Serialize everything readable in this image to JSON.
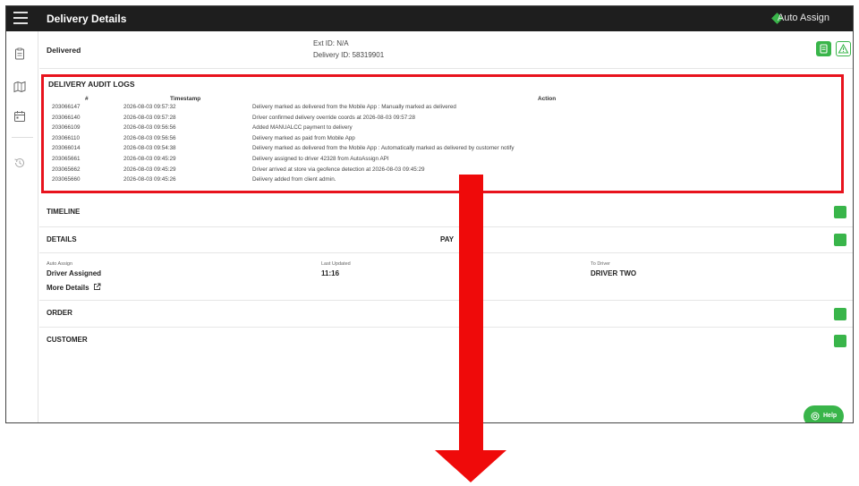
{
  "header": {
    "title": "Delivery Details",
    "auto_assign_label": "Auto Assign"
  },
  "colors": {
    "accent": "#39b54a",
    "highlight": "#e8131d",
    "topbar": "#1e1e1e"
  },
  "status": {
    "label": "Delivered",
    "ext_id": "Ext ID: N/A",
    "delivery_id": "Delivery ID: 58319901"
  },
  "audit": {
    "title": "DELIVERY AUDIT LOGS",
    "columns": [
      "#",
      "Timestamp",
      "Action"
    ],
    "rows": [
      {
        "id": "203066147",
        "timestamp": "2026-08-03 09:57:32",
        "action": "Delivery marked as delivered from the Mobile App : Manually marked as delivered"
      },
      {
        "id": "203066140",
        "timestamp": "2026-08-03 09:57:28",
        "action": "Driver confirmed delivery override coords at 2026-08-03 09:57:28"
      },
      {
        "id": "203066109",
        "timestamp": "2026-08-03 09:56:56",
        "action": "Added MANUALCC payment to delivery"
      },
      {
        "id": "203066110",
        "timestamp": "2026-08-03 09:56:56",
        "action": "Delivery marked as paid from Mobile App"
      },
      {
        "id": "203066014",
        "timestamp": "2026-08-03 09:54:38",
        "action": "Delivery marked as delivered from the Mobile App : Automatically marked as delivered by customer notify"
      },
      {
        "id": "203065661",
        "timestamp": "2026-08-03 09:45:29",
        "action": "Delivery assigned to driver 42328 from AutoAssign API"
      },
      {
        "id": "203065662",
        "timestamp": "2026-08-03 09:45:29",
        "action": "Driver arrived at store via geofence detection at 2026-08-03 09:45:29"
      },
      {
        "id": "203065660",
        "timestamp": "2026-08-03 09:45:26",
        "action": "Delivery added from client admin."
      }
    ]
  },
  "sections": {
    "timeline": "TIMELINE",
    "details": "DETAILS",
    "payment": "PAY",
    "order": "ORDER",
    "customer": "CUSTOMER"
  },
  "details": {
    "auto_assign_label": "Auto Assign",
    "auto_assign_value": "Driver Assigned",
    "last_updated_label": "Last Updated",
    "last_updated_value": "11:16",
    "to_driver_label": "To Driver",
    "to_driver_value": "DRIVER TWO",
    "more_details": "More Details"
  },
  "help": {
    "label": "Help"
  },
  "icons": {
    "menu": "hamburger-menu-icon",
    "auto_assign": "green-diamond-icon",
    "sidebar": [
      "clipboard-icon",
      "map-icon",
      "calendar-icon",
      "history-icon"
    ],
    "document": "document-icon",
    "warning": "warning-icon",
    "chevron": "chevron-down-icon",
    "external": "external-link-icon",
    "help": "lifebuoy-icon",
    "annotation": "red-down-arrow-icon"
  }
}
